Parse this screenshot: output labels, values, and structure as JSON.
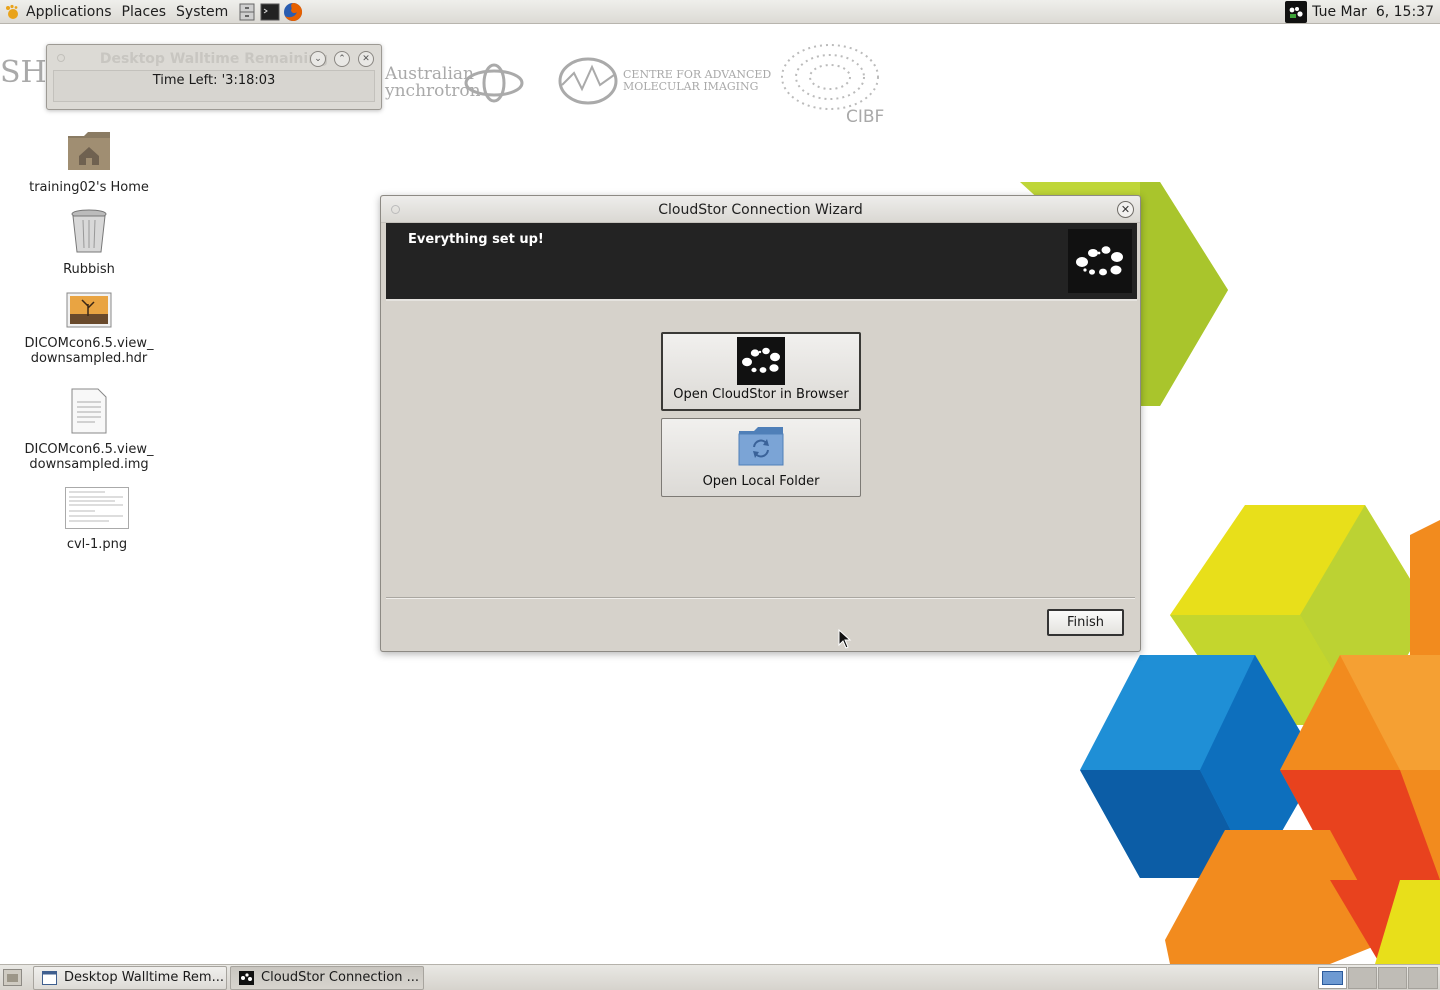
{
  "top_panel": {
    "menus": [
      "Applications",
      "Places",
      "System"
    ],
    "clock": "Tue Mar  6, 15:37"
  },
  "background_logos": {
    "partial_left": "SH",
    "synchrotron_line1": "Australian",
    "synchrotron_line2": "ynchrotron",
    "caim_line1": "CENTRE FOR ADVANCED",
    "caim_line2": "MOLECULAR IMAGING",
    "cibf": "CIBF"
  },
  "desktop_icons": [
    {
      "label": "training02's Home"
    },
    {
      "label": "Rubbish"
    },
    {
      "label": "DICOMcon6.5.view_\ndownsampled.hdr"
    },
    {
      "label": "DICOMcon6.5.view_\ndownsampled.img"
    },
    {
      "label": "cvl-1.png"
    }
  ],
  "walltime_window": {
    "title": "Desktop Walltime Remaining",
    "time_left": "Time Left: '3:18:03"
  },
  "wizard": {
    "title": "CloudStor Connection Wizard",
    "heading": "Everything set up!",
    "open_browser_label": "Open CloudStor in Browser",
    "open_folder_label": "Open Local Folder",
    "finish_label": "Finish"
  },
  "taskbar": {
    "tasks": [
      "Desktop Walltime Rem...",
      "CloudStor Connection ..."
    ]
  },
  "colors": {
    "cube_yellow": "#e8df1a",
    "cube_lime": "#bfd638",
    "cube_blue": "#1f8fd6",
    "cube_orange": "#f28b1e",
    "cube_red": "#e8421e",
    "header_dark": "#232323"
  }
}
